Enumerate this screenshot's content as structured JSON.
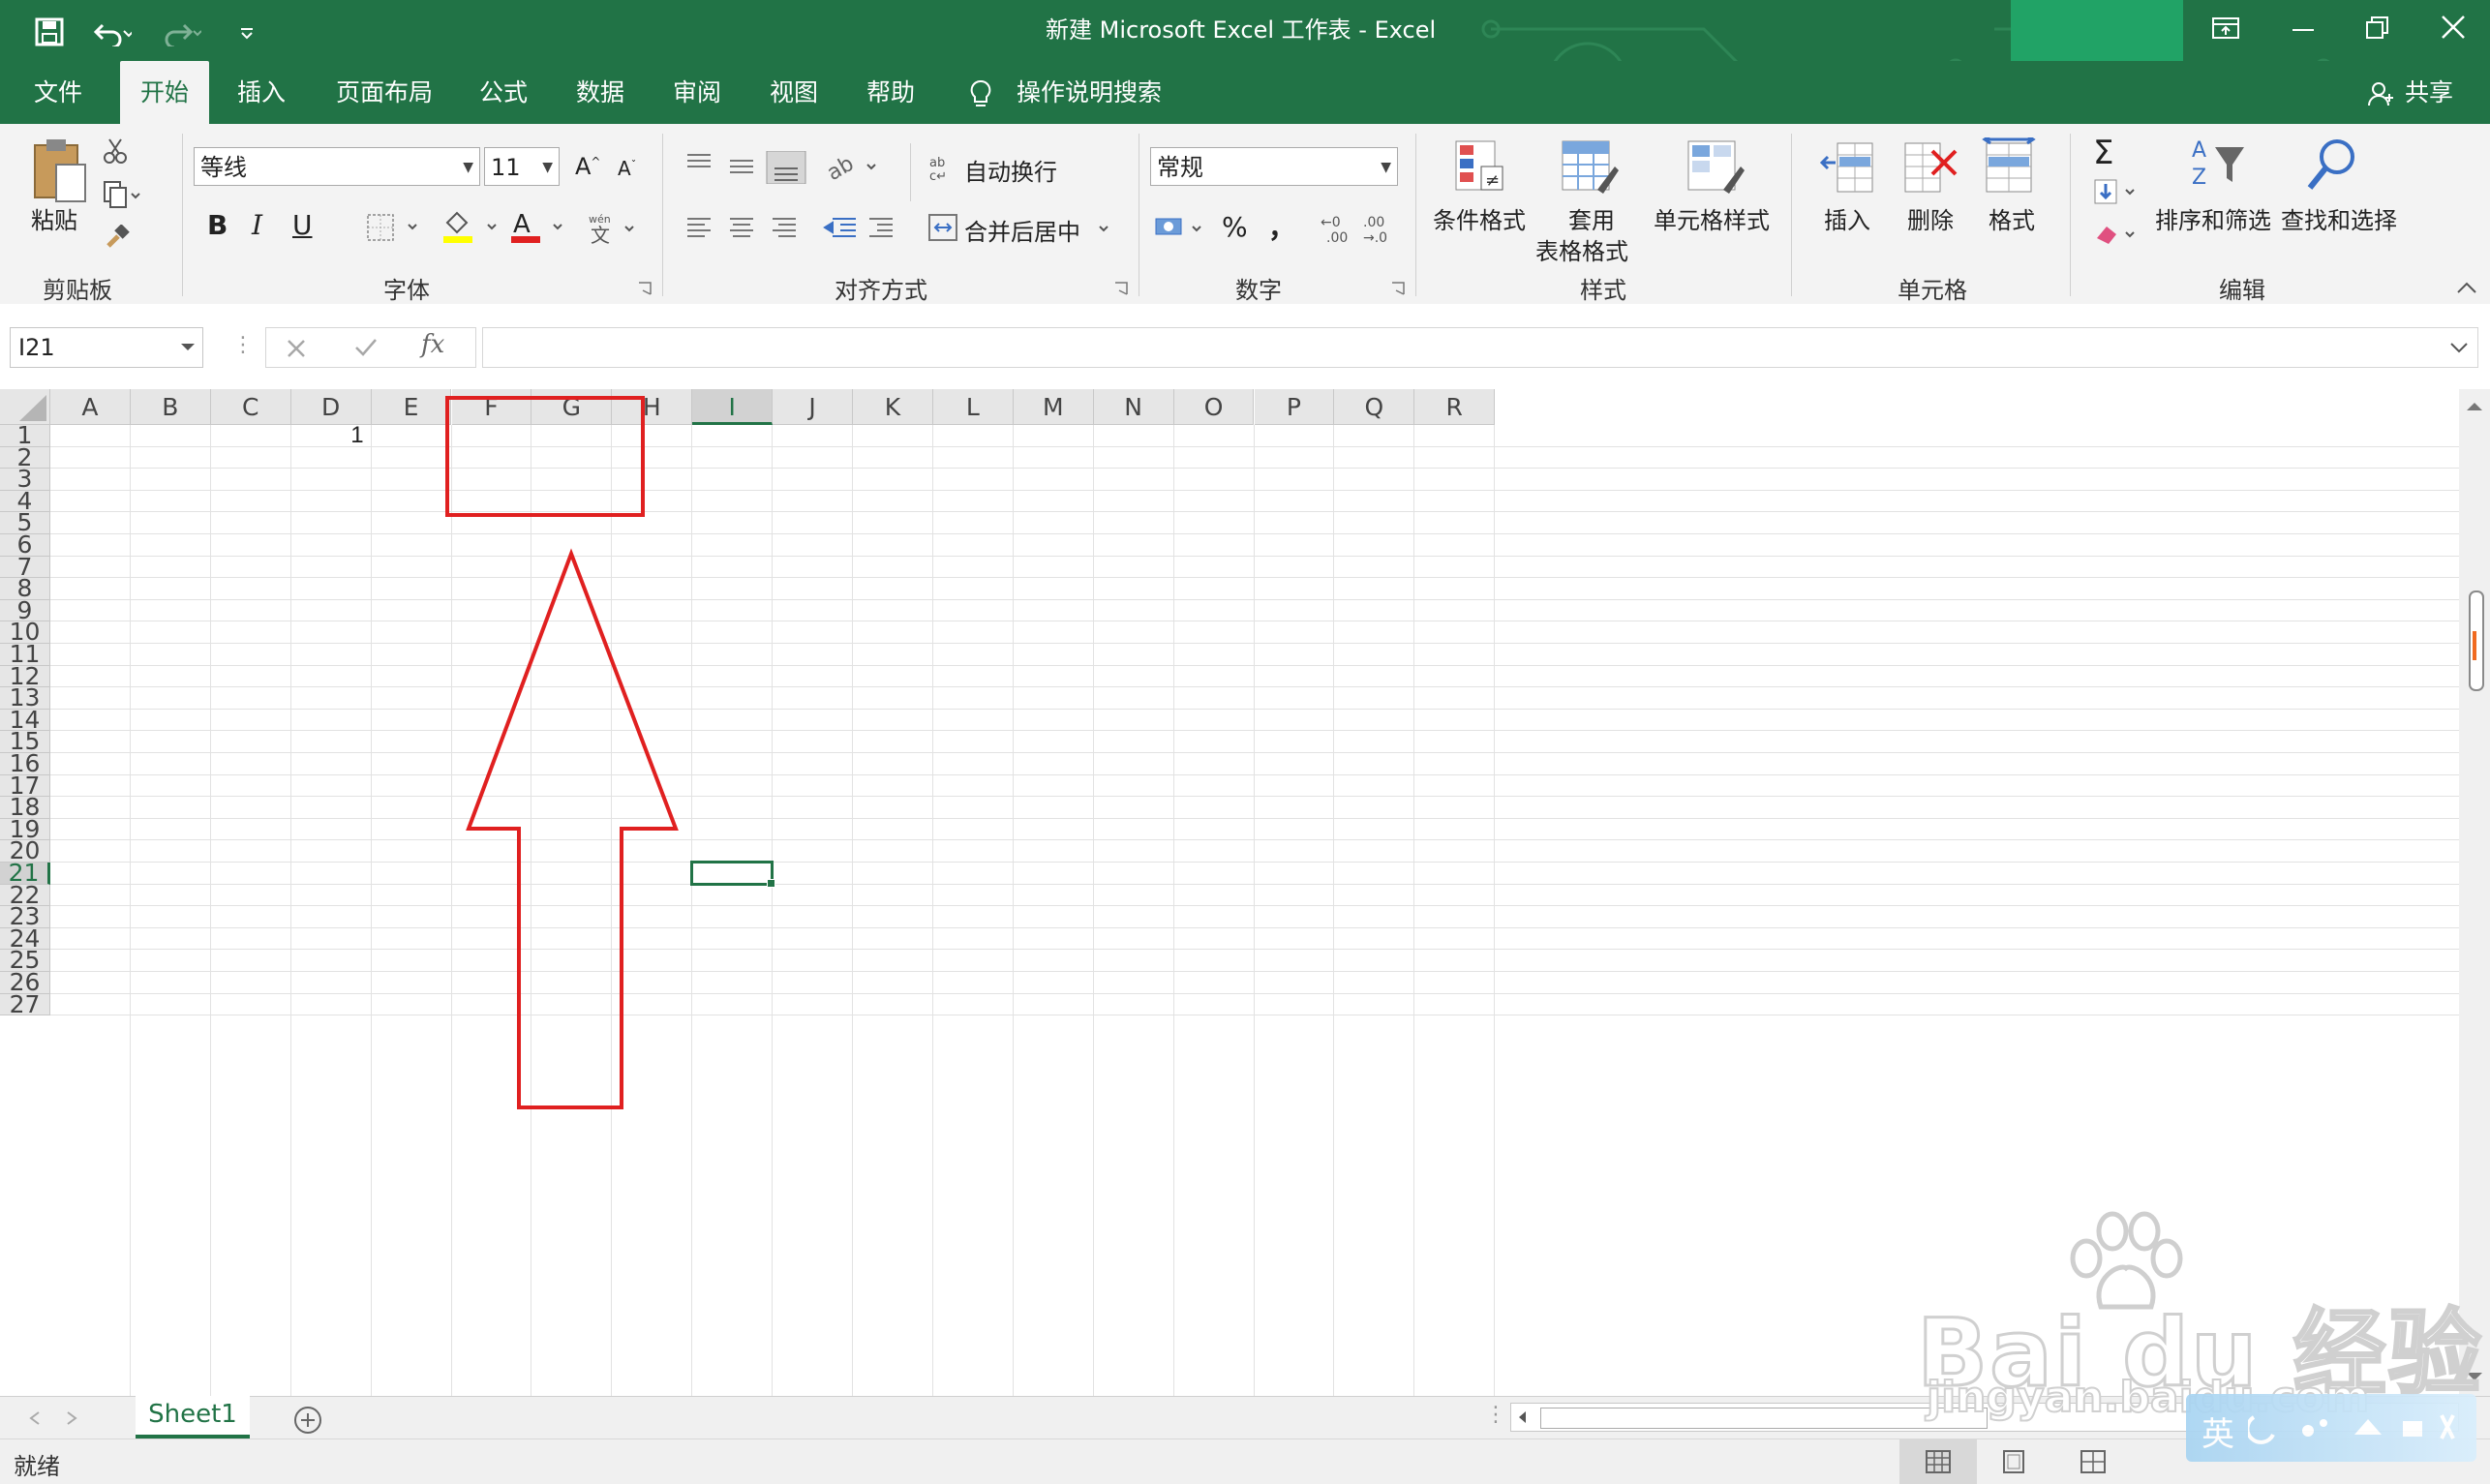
{
  "window": {
    "title": "新建 Microsoft Excel 工作表  -  Excel",
    "share_label": "共享"
  },
  "tabs": [
    {
      "label": "文件",
      "active": false
    },
    {
      "label": "开始",
      "active": true
    },
    {
      "label": "插入",
      "active": false
    },
    {
      "label": "页面布局",
      "active": false
    },
    {
      "label": "公式",
      "active": false
    },
    {
      "label": "数据",
      "active": false
    },
    {
      "label": "审阅",
      "active": false
    },
    {
      "label": "视图",
      "active": false
    },
    {
      "label": "帮助",
      "active": false
    }
  ],
  "tell_me": "操作说明搜索",
  "ribbon": {
    "clipboard": {
      "paste": "粘贴",
      "label": "剪贴板"
    },
    "font": {
      "name": "等线",
      "size": "11",
      "label": "字体",
      "bold": "B",
      "italic": "I",
      "underline": "U"
    },
    "alignment": {
      "wrap": "自动换行",
      "merge": "合并后居中",
      "label": "对齐方式"
    },
    "number": {
      "format": "常规",
      "label": "数字",
      "percent": "%",
      "comma": "，"
    },
    "styles": {
      "conditional": "条件格式",
      "table": "套用",
      "table2": "表格格式",
      "cell": "单元格样式",
      "label": "样式"
    },
    "cells": {
      "insert": "插入",
      "delete": "删除",
      "format": "格式",
      "label": "单元格"
    },
    "editing": {
      "sort": "排序和筛选",
      "find": "查找和选择",
      "label": "编辑"
    }
  },
  "formula_bar": {
    "name_box": "I21",
    "fx": "fx",
    "content": ""
  },
  "columns": [
    "A",
    "B",
    "C",
    "D",
    "E",
    "F",
    "G",
    "H",
    "I",
    "J",
    "K",
    "L",
    "M",
    "N",
    "O",
    "P",
    "Q",
    "R"
  ],
  "rows": [
    "1",
    "2",
    "3",
    "4",
    "5",
    "6",
    "7",
    "8",
    "9",
    "10",
    "11",
    "12",
    "13",
    "14",
    "15",
    "16",
    "17",
    "18",
    "19",
    "20",
    "21",
    "22",
    "23",
    "24",
    "25",
    "26",
    "27"
  ],
  "active_cell": "I21",
  "cells": [
    {
      "ref": "D1",
      "value": "1"
    }
  ],
  "sheets": [
    {
      "name": "Sheet1",
      "active": true
    }
  ],
  "status": {
    "ready": "就绪"
  },
  "watermark": {
    "brand": "Bai du 经验",
    "url": "jingyan.baidu.com"
  },
  "ime": {
    "lang": "英"
  },
  "colors": {
    "excel_green": "#217346",
    "annotation_red": "#e02020",
    "accent_bright": "#21a366"
  }
}
